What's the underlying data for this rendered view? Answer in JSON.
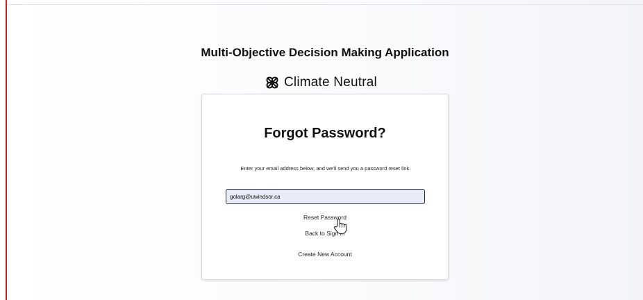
{
  "app": {
    "title": "Multi-Objective Decision Making Application"
  },
  "brand": {
    "name": "Climate Neutral",
    "logo_icon": "climate-neutral-logo-icon"
  },
  "form": {
    "title": "Forgot Password?",
    "instructions": "Enter your email address below, and we'll send you a password reset link.",
    "email_value": "golarg@uwindsor.ca",
    "reset_label": "Reset Password",
    "back_label": "Back to Sign In",
    "create_label": "Create New Account"
  },
  "colors": {
    "accent_edge": "#b3202e",
    "input_fill": "#e8ebf8"
  }
}
